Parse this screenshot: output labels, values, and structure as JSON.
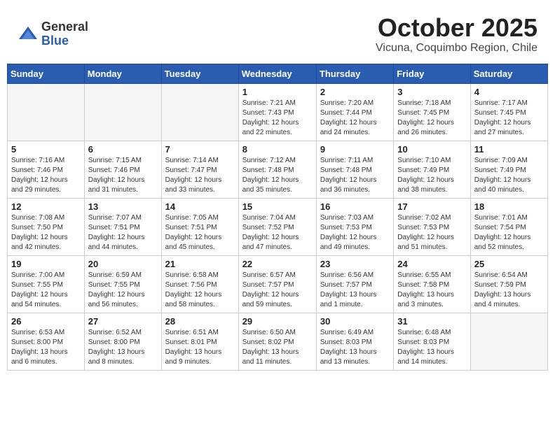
{
  "header": {
    "logo_general": "General",
    "logo_blue": "Blue",
    "month": "October 2025",
    "location": "Vicuna, Coquimbo Region, Chile"
  },
  "days_of_week": [
    "Sunday",
    "Monday",
    "Tuesday",
    "Wednesday",
    "Thursday",
    "Friday",
    "Saturday"
  ],
  "weeks": [
    [
      {
        "day": "",
        "info": ""
      },
      {
        "day": "",
        "info": ""
      },
      {
        "day": "",
        "info": ""
      },
      {
        "day": "1",
        "info": "Sunrise: 7:21 AM\nSunset: 7:43 PM\nDaylight: 12 hours\nand 22 minutes."
      },
      {
        "day": "2",
        "info": "Sunrise: 7:20 AM\nSunset: 7:44 PM\nDaylight: 12 hours\nand 24 minutes."
      },
      {
        "day": "3",
        "info": "Sunrise: 7:18 AM\nSunset: 7:45 PM\nDaylight: 12 hours\nand 26 minutes."
      },
      {
        "day": "4",
        "info": "Sunrise: 7:17 AM\nSunset: 7:45 PM\nDaylight: 12 hours\nand 27 minutes."
      }
    ],
    [
      {
        "day": "5",
        "info": "Sunrise: 7:16 AM\nSunset: 7:46 PM\nDaylight: 12 hours\nand 29 minutes."
      },
      {
        "day": "6",
        "info": "Sunrise: 7:15 AM\nSunset: 7:46 PM\nDaylight: 12 hours\nand 31 minutes."
      },
      {
        "day": "7",
        "info": "Sunrise: 7:14 AM\nSunset: 7:47 PM\nDaylight: 12 hours\nand 33 minutes."
      },
      {
        "day": "8",
        "info": "Sunrise: 7:12 AM\nSunset: 7:48 PM\nDaylight: 12 hours\nand 35 minutes."
      },
      {
        "day": "9",
        "info": "Sunrise: 7:11 AM\nSunset: 7:48 PM\nDaylight: 12 hours\nand 36 minutes."
      },
      {
        "day": "10",
        "info": "Sunrise: 7:10 AM\nSunset: 7:49 PM\nDaylight: 12 hours\nand 38 minutes."
      },
      {
        "day": "11",
        "info": "Sunrise: 7:09 AM\nSunset: 7:49 PM\nDaylight: 12 hours\nand 40 minutes."
      }
    ],
    [
      {
        "day": "12",
        "info": "Sunrise: 7:08 AM\nSunset: 7:50 PM\nDaylight: 12 hours\nand 42 minutes."
      },
      {
        "day": "13",
        "info": "Sunrise: 7:07 AM\nSunset: 7:51 PM\nDaylight: 12 hours\nand 44 minutes."
      },
      {
        "day": "14",
        "info": "Sunrise: 7:05 AM\nSunset: 7:51 PM\nDaylight: 12 hours\nand 45 minutes."
      },
      {
        "day": "15",
        "info": "Sunrise: 7:04 AM\nSunset: 7:52 PM\nDaylight: 12 hours\nand 47 minutes."
      },
      {
        "day": "16",
        "info": "Sunrise: 7:03 AM\nSunset: 7:53 PM\nDaylight: 12 hours\nand 49 minutes."
      },
      {
        "day": "17",
        "info": "Sunrise: 7:02 AM\nSunset: 7:53 PM\nDaylight: 12 hours\nand 51 minutes."
      },
      {
        "day": "18",
        "info": "Sunrise: 7:01 AM\nSunset: 7:54 PM\nDaylight: 12 hours\nand 52 minutes."
      }
    ],
    [
      {
        "day": "19",
        "info": "Sunrise: 7:00 AM\nSunset: 7:55 PM\nDaylight: 12 hours\nand 54 minutes."
      },
      {
        "day": "20",
        "info": "Sunrise: 6:59 AM\nSunset: 7:55 PM\nDaylight: 12 hours\nand 56 minutes."
      },
      {
        "day": "21",
        "info": "Sunrise: 6:58 AM\nSunset: 7:56 PM\nDaylight: 12 hours\nand 58 minutes."
      },
      {
        "day": "22",
        "info": "Sunrise: 6:57 AM\nSunset: 7:57 PM\nDaylight: 12 hours\nand 59 minutes."
      },
      {
        "day": "23",
        "info": "Sunrise: 6:56 AM\nSunset: 7:57 PM\nDaylight: 13 hours\nand 1 minute."
      },
      {
        "day": "24",
        "info": "Sunrise: 6:55 AM\nSunset: 7:58 PM\nDaylight: 13 hours\nand 3 minutes."
      },
      {
        "day": "25",
        "info": "Sunrise: 6:54 AM\nSunset: 7:59 PM\nDaylight: 13 hours\nand 4 minutes."
      }
    ],
    [
      {
        "day": "26",
        "info": "Sunrise: 6:53 AM\nSunset: 8:00 PM\nDaylight: 13 hours\nand 6 minutes."
      },
      {
        "day": "27",
        "info": "Sunrise: 6:52 AM\nSunset: 8:00 PM\nDaylight: 13 hours\nand 8 minutes."
      },
      {
        "day": "28",
        "info": "Sunrise: 6:51 AM\nSunset: 8:01 PM\nDaylight: 13 hours\nand 9 minutes."
      },
      {
        "day": "29",
        "info": "Sunrise: 6:50 AM\nSunset: 8:02 PM\nDaylight: 13 hours\nand 11 minutes."
      },
      {
        "day": "30",
        "info": "Sunrise: 6:49 AM\nSunset: 8:03 PM\nDaylight: 13 hours\nand 13 minutes."
      },
      {
        "day": "31",
        "info": "Sunrise: 6:48 AM\nSunset: 8:03 PM\nDaylight: 13 hours\nand 14 minutes."
      },
      {
        "day": "",
        "info": ""
      }
    ]
  ]
}
